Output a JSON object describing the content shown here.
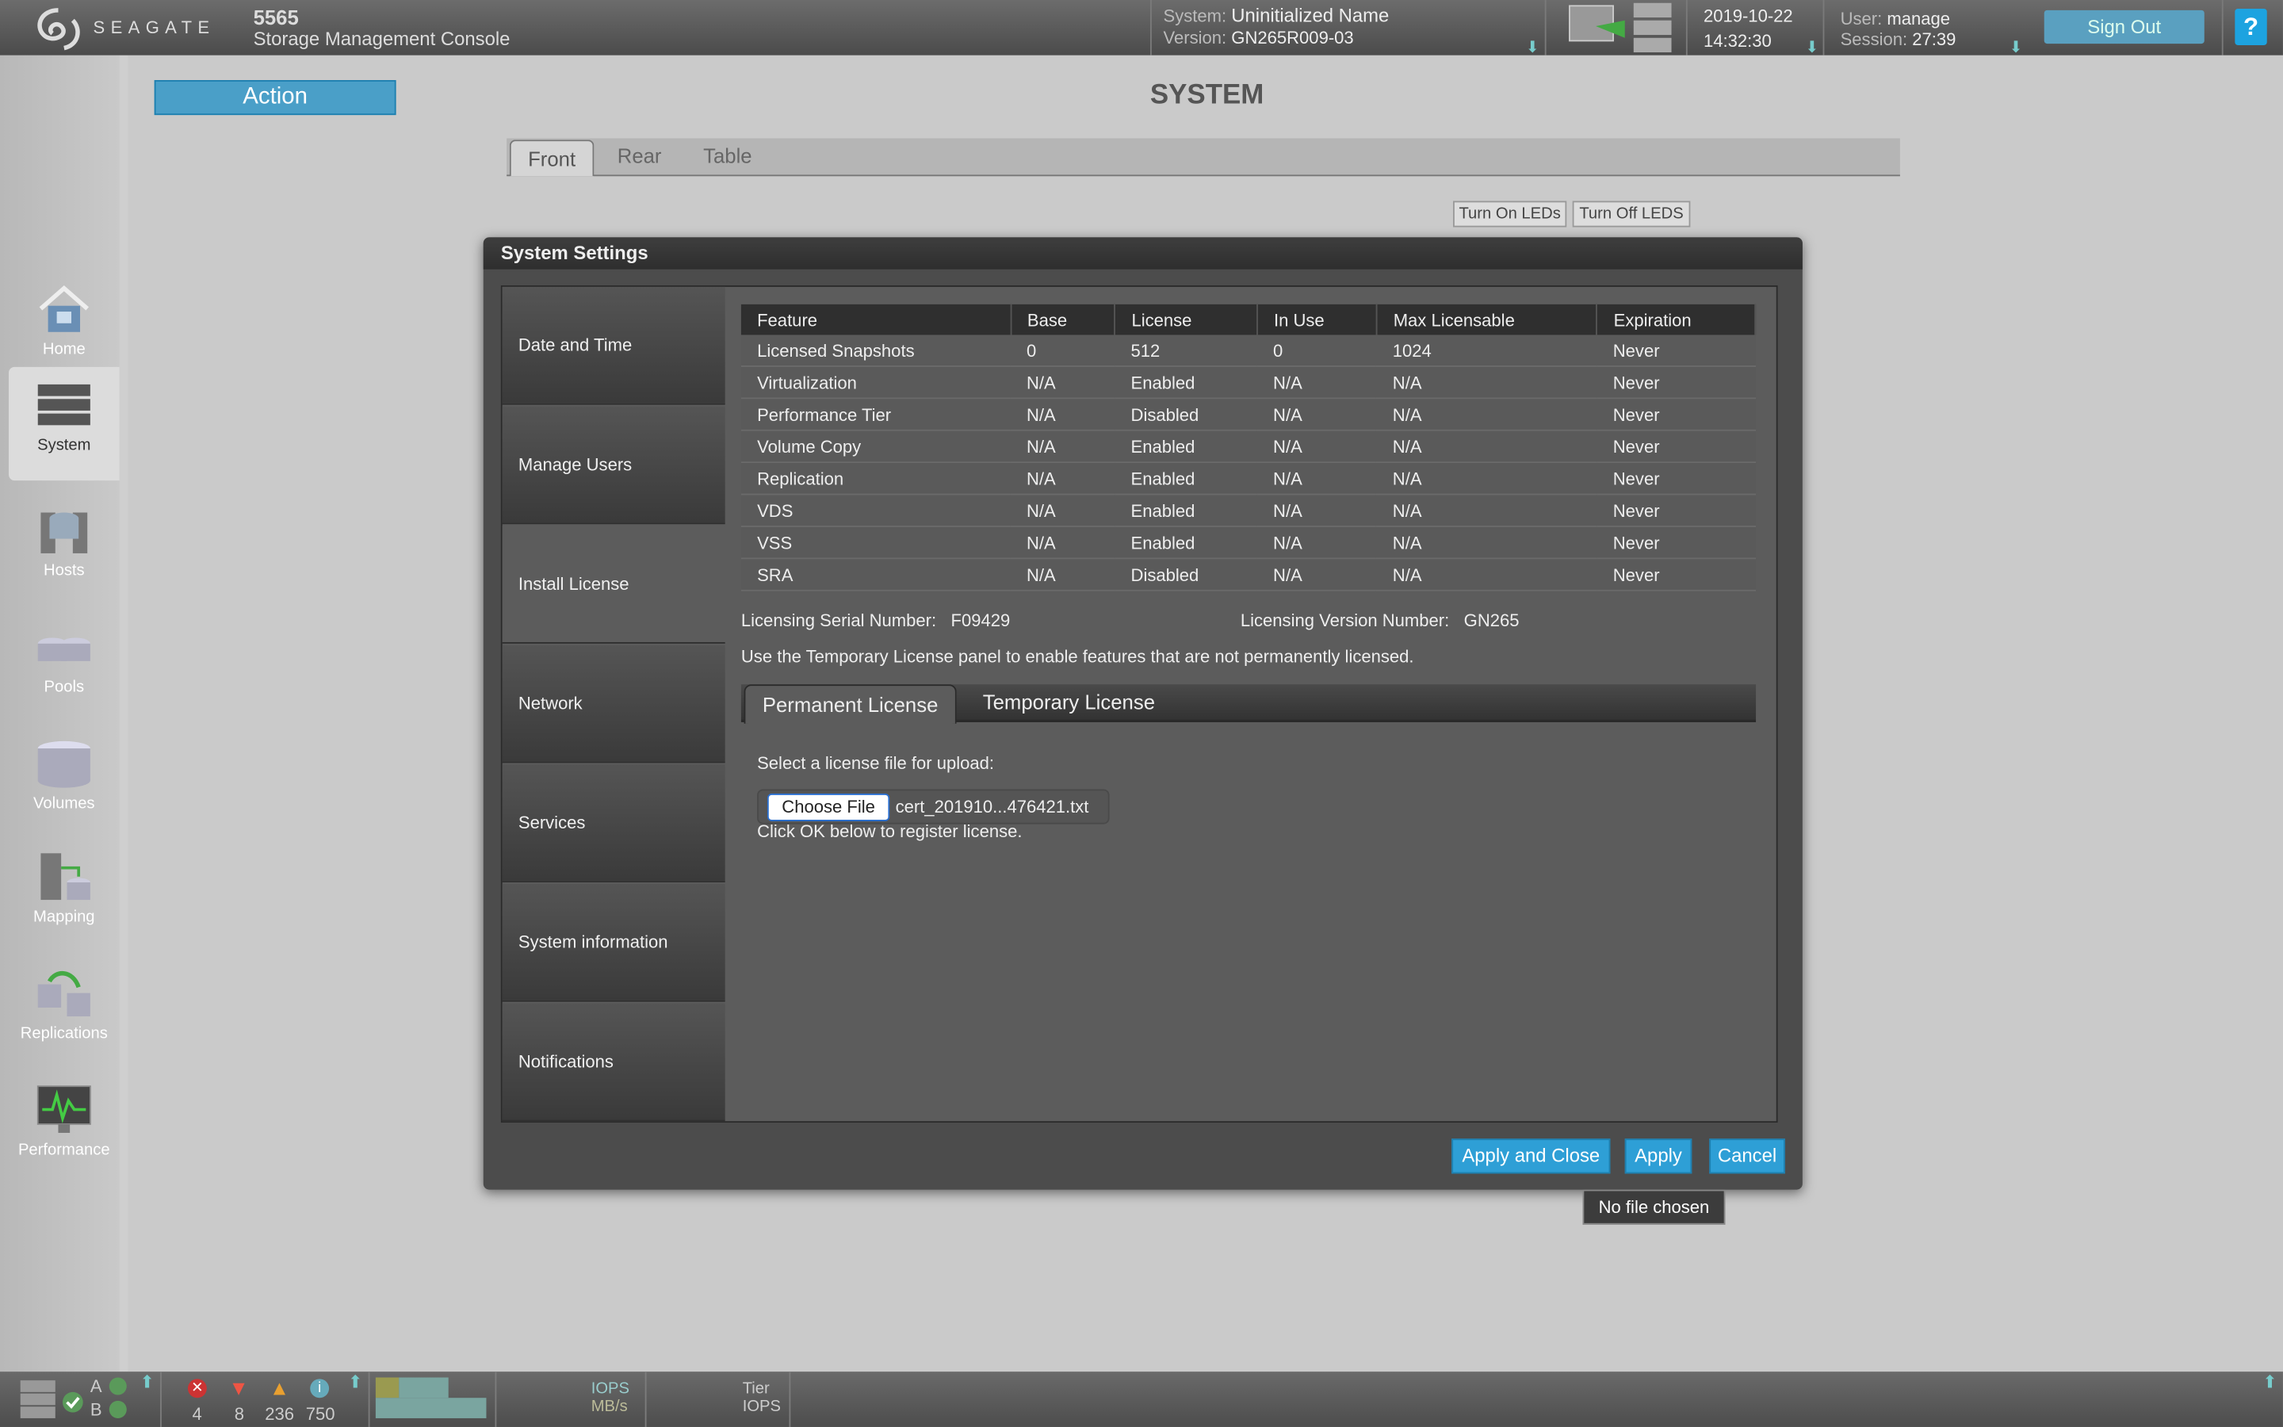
{
  "header": {
    "brand": "SEAGATE",
    "model": "5565",
    "app_title": "Storage Management Console",
    "system_label": "System:",
    "system_value": "Uninitialized Name",
    "version_label": "Version:",
    "version_value": "GN265R009-03",
    "date": "2019-10-22",
    "time": "14:32:30",
    "user_label": "User:",
    "user_value": "manage",
    "session_label": "Session:",
    "session_value": "27:39",
    "sign_out": "Sign Out",
    "help": "?"
  },
  "sidebar": {
    "items": [
      {
        "label": "Home",
        "icon": "home-icon"
      },
      {
        "label": "System",
        "icon": "system-icon",
        "selected": true
      },
      {
        "label": "Hosts",
        "icon": "hosts-icon"
      },
      {
        "label": "Pools",
        "icon": "pools-icon"
      },
      {
        "label": "Volumes",
        "icon": "volumes-icon"
      },
      {
        "label": "Mapping",
        "icon": "mapping-icon"
      },
      {
        "label": "Replications",
        "icon": "replications-icon"
      },
      {
        "label": "Performance",
        "icon": "performance-icon"
      }
    ]
  },
  "main": {
    "action": "Action",
    "title": "SYSTEM",
    "tabs": [
      "Front",
      "Rear",
      "Table"
    ],
    "active_tab": "Front",
    "led_on": "Turn On LEDs",
    "led_off": "Turn Off LEDS"
  },
  "modal": {
    "title": "System Settings",
    "nav": [
      "Date and Time",
      "Manage Users",
      "Install License",
      "Network",
      "Services",
      "System information",
      "Notifications"
    ],
    "active_nav": "Install License",
    "table": {
      "headers": [
        "Feature",
        "Base",
        "License",
        "In Use",
        "Max Licensable",
        "Expiration"
      ],
      "rows": [
        [
          "Licensed Snapshots",
          "0",
          "512",
          "0",
          "1024",
          "Never"
        ],
        [
          "Virtualization",
          "N/A",
          "Enabled",
          "N/A",
          "N/A",
          "Never"
        ],
        [
          "Performance Tier",
          "N/A",
          "Disabled",
          "N/A",
          "N/A",
          "Never"
        ],
        [
          "Volume Copy",
          "N/A",
          "Enabled",
          "N/A",
          "N/A",
          "Never"
        ],
        [
          "Replication",
          "N/A",
          "Enabled",
          "N/A",
          "N/A",
          "Never"
        ],
        [
          "VDS",
          "N/A",
          "Enabled",
          "N/A",
          "N/A",
          "Never"
        ],
        [
          "VSS",
          "N/A",
          "Enabled",
          "N/A",
          "N/A",
          "Never"
        ],
        [
          "SRA",
          "N/A",
          "Disabled",
          "N/A",
          "N/A",
          "Never"
        ]
      ]
    },
    "serial_label": "Licensing Serial Number:",
    "serial_value": "F09429",
    "version_label": "Licensing Version Number:",
    "version_value": "GN265",
    "note": "Use the Temporary License panel to enable features that are not permanently licensed.",
    "license_tabs": [
      "Permanent License",
      "Temporary License"
    ],
    "select_label": "Select a license file for upload:",
    "choose_file": "Choose File",
    "file_name": "cert_201910...476421.txt",
    "click_ok": "Click OK below to register license.",
    "apply_close": "Apply and Close",
    "apply": "Apply",
    "cancel": "Cancel",
    "tooltip": "No file chosen"
  },
  "footer": {
    "controller_a": "A",
    "controller_b": "B",
    "errors": "4",
    "critical": "8",
    "warnings": "236",
    "info": "750",
    "iops_label": "IOPS",
    "mbs_label": "MB/s",
    "tier_label": "Tier",
    "tier_iops_label": "IOPS"
  },
  "colors": {
    "accent": "#2e9fd6",
    "action": "#4a9fc8"
  }
}
